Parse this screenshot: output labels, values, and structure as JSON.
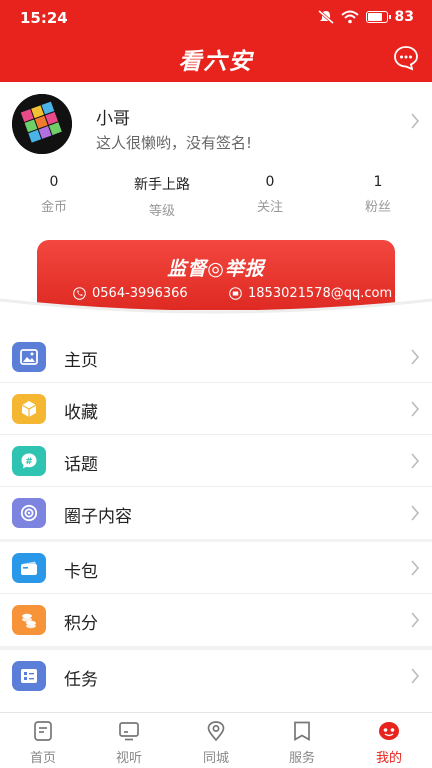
{
  "status_bar": {
    "time": "15:24",
    "battery": "83",
    "battery_level": 0.83
  },
  "header": {
    "title": "看六安",
    "message_icon": "chat-bubble-icon"
  },
  "profile": {
    "username": "小哥",
    "signature": "这人很懒哟，没有签名!",
    "stats": [
      {
        "value": "0",
        "label": "金币"
      },
      {
        "value": "新手上路",
        "label": "等级"
      },
      {
        "value": "0",
        "label": "关注"
      },
      {
        "value": "1",
        "label": "粉丝"
      }
    ]
  },
  "banner": {
    "title": "监督◎举报",
    "phone": "0564-3996366",
    "email": "1853021578@qq.com"
  },
  "menu_group_1": [
    {
      "label": "主页",
      "icon": "image-icon",
      "color": "#5b7fd8"
    },
    {
      "label": "收藏",
      "icon": "box-icon",
      "color": "#f5b632"
    },
    {
      "label": "话题",
      "icon": "hashtag-icon",
      "color": "#2fc4b2"
    },
    {
      "label": "圈子内容",
      "icon": "circle-icon",
      "color": "#7d84e0"
    }
  ],
  "menu_group_2": [
    {
      "label": "卡包",
      "icon": "card-icon",
      "color": "#2a98e8"
    },
    {
      "label": "积分",
      "icon": "coins-icon",
      "color": "#f7943a"
    }
  ],
  "menu_group_3": [
    {
      "label": "任务",
      "icon": "task-icon",
      "color": "#5b7fd8"
    }
  ],
  "tabbar": [
    {
      "label": "首页",
      "icon": "home-icon"
    },
    {
      "label": "视听",
      "icon": "tv-icon"
    },
    {
      "label": "同城",
      "icon": "location-icon"
    },
    {
      "label": "服务",
      "icon": "bookmark-icon"
    },
    {
      "label": "我的",
      "icon": "me-icon",
      "active": true
    }
  ],
  "colors": {
    "brand": "#e8231d"
  }
}
